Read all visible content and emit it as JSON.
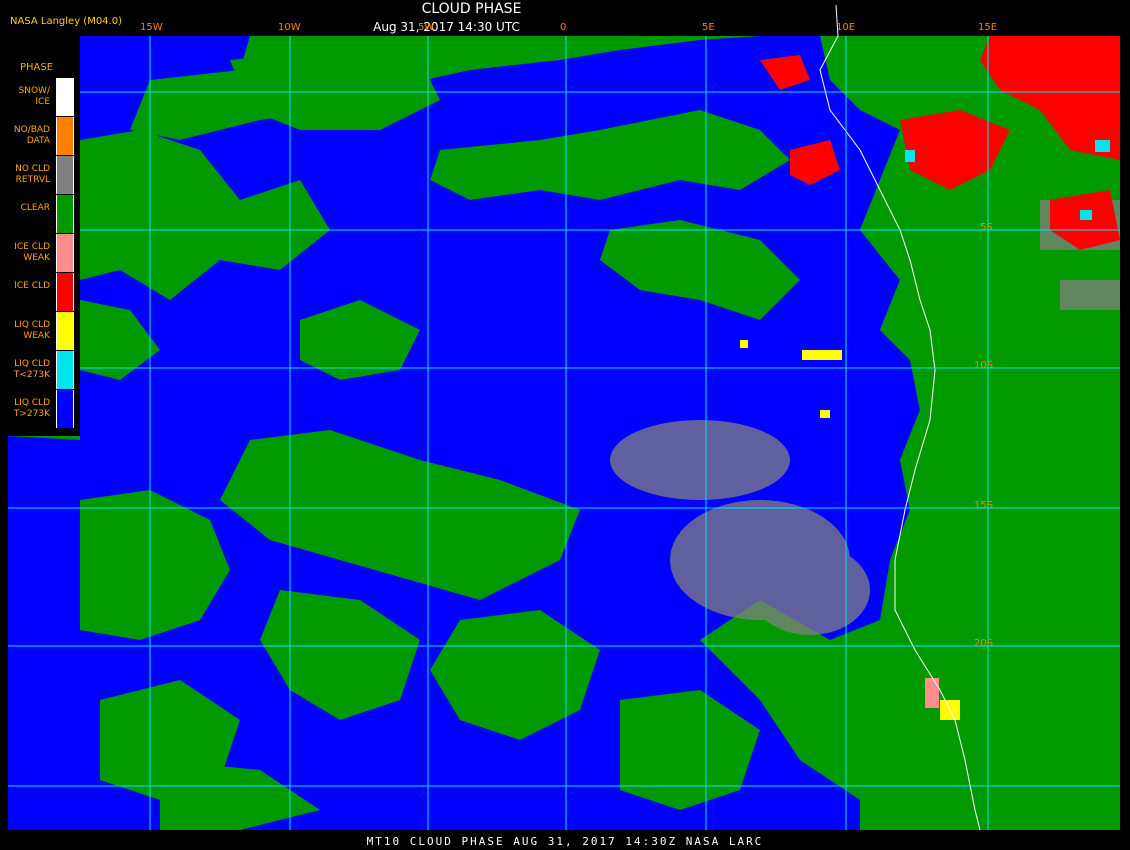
{
  "header": {
    "credit": "NASA Langley (M04.0)",
    "title": "CLOUD PHASE",
    "subtitle": "Aug 31, 2017 14:30 UTC"
  },
  "legend": {
    "title": "PHASE",
    "items": [
      {
        "label": "SNOW/\nICE",
        "color": "#ffffff"
      },
      {
        "label": "NO/BAD\nDATA",
        "color": "#ff8000"
      },
      {
        "label": "NO CLD\nRETRVL",
        "color": "#808080"
      },
      {
        "label": "CLEAR",
        "color": "#009900"
      },
      {
        "label": "ICE CLD\nWEAK",
        "color": "#ff8c8c"
      },
      {
        "label": "ICE CLD",
        "color": "#ff0000"
      },
      {
        "label": "LIQ CLD\nWEAK",
        "color": "#ffff00"
      },
      {
        "label": "LIQ CLD\nT<273K",
        "color": "#00e5ee"
      },
      {
        "label": "LIQ CLD\nT>273K",
        "color": "#0000ff"
      }
    ]
  },
  "grid": {
    "longitudes": [
      "15W",
      "10W",
      "5W",
      "0",
      "5E",
      "10E",
      "15E"
    ],
    "latitudes": [
      "5S",
      "10S",
      "15S",
      "20S"
    ]
  },
  "footer": "MT10  CLOUD PHASE  AUG 31, 2017 14:30Z  NASA LARC",
  "colors": {
    "clear": "#009900",
    "liq_warm": "#0000ff",
    "liq_cold": "#00e5ee",
    "ice": "#ff0000",
    "ice_weak": "#ff8c8c",
    "liq_weak": "#ffff00",
    "no_retrieval": "#808080",
    "grid": "#00e5ee",
    "label": "#ff7f00"
  }
}
